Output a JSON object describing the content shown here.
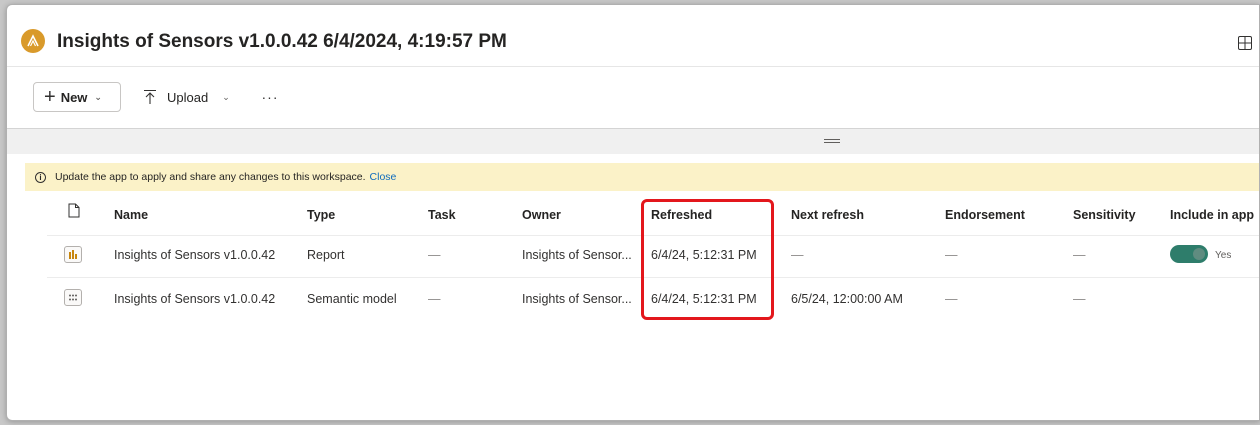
{
  "header": {
    "title": "Insights of Sensors v1.0.0.42 6/4/2024, 4:19:57 PM",
    "logo_icon": "workspace-logo-icon",
    "logo_color": "#d99a2b"
  },
  "toolbar": {
    "new_label": "New",
    "upload_label": "Upload",
    "more_label": "···"
  },
  "banner": {
    "message": "Update the app to apply and share any changes to this workspace.",
    "close_label": "Close",
    "background": "#fbf2c8"
  },
  "table": {
    "columns": [
      "Name",
      "Type",
      "Task",
      "Owner",
      "Refreshed",
      "Next refresh",
      "Endorsement",
      "Sensitivity",
      "Include in app"
    ],
    "rows": [
      {
        "icon": "report-icon",
        "name": "Insights of Sensors v1.0.0.42",
        "type": "Report",
        "task": "—",
        "owner": "Insights of Sensor...",
        "refreshed": "6/4/24, 5:12:31 PM",
        "next_refresh": "—",
        "endorsement": "—",
        "sensitivity": "—",
        "include_in_app": "Yes"
      },
      {
        "icon": "semantic-model-icon",
        "name": "Insights of Sensors v1.0.0.42",
        "type": "Semantic model",
        "task": "—",
        "owner": "Insights of Sensor...",
        "refreshed": "6/4/24, 5:12:31 PM",
        "next_refresh": "6/5/24, 12:00:00 AM",
        "endorsement": "—",
        "sensitivity": "—",
        "include_in_app": ""
      }
    ]
  },
  "colors": {
    "accent_toggle": "#2e7d6b",
    "highlight": "#e3171c",
    "link": "#0f6cbd"
  }
}
